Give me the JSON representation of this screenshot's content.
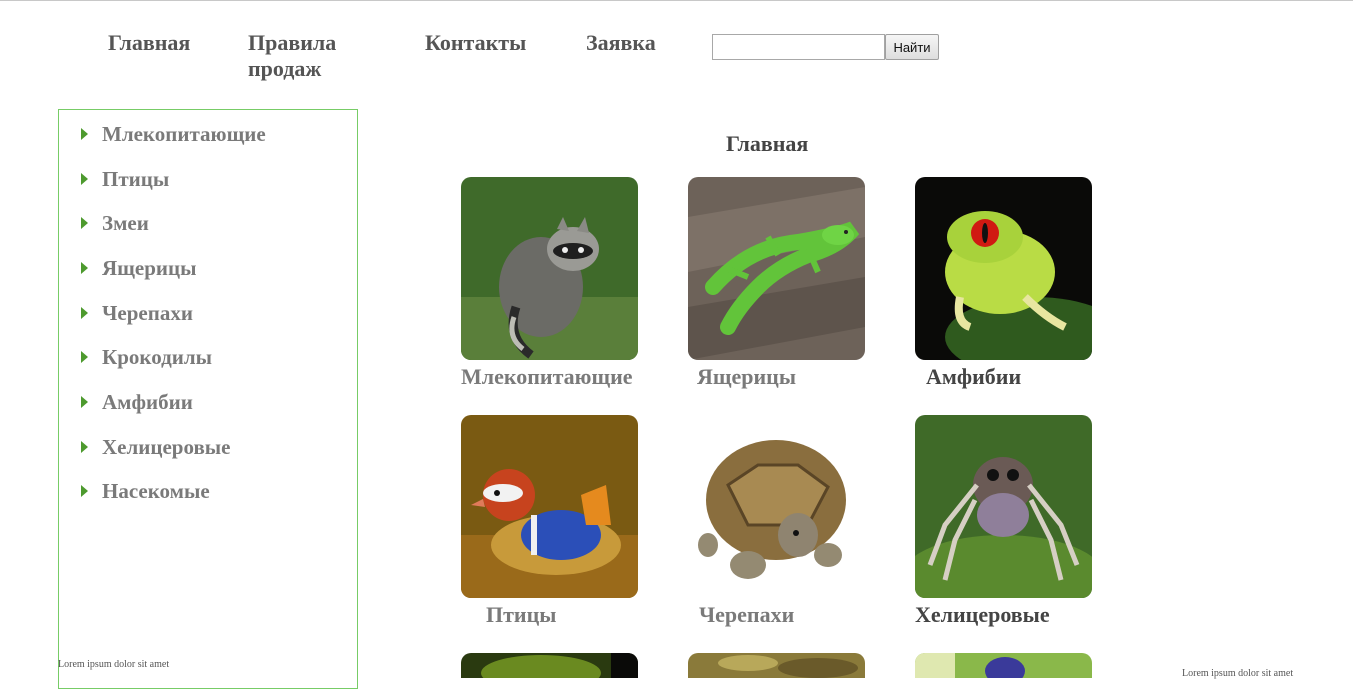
{
  "nav": {
    "home": "Главная",
    "rules": "Правила продаж",
    "contacts": "Контакты",
    "apply": "Заявка"
  },
  "search": {
    "value": "",
    "button": "Найти"
  },
  "sidebar": {
    "items": [
      {
        "label": "Млекопитающие"
      },
      {
        "label": "Птицы"
      },
      {
        "label": "Змеи"
      },
      {
        "label": "Ящерицы"
      },
      {
        "label": "Черепахи"
      },
      {
        "label": "Крокодилы"
      },
      {
        "label": "Амфибии"
      },
      {
        "label": "Хелицеровые"
      },
      {
        "label": "Насекомые"
      }
    ]
  },
  "main": {
    "title": "Главная",
    "cards": [
      {
        "label": "Млекопитающие"
      },
      {
        "label": "Ящерицы"
      },
      {
        "label": "Амфибии"
      },
      {
        "label": "Птицы"
      },
      {
        "label": "Черепахи"
      },
      {
        "label": "Хелицеровые"
      }
    ]
  },
  "footer": {
    "left_text": "Lorem ipsum dolor sit amet",
    "right_text": "Lorem ipsum dolor sit amet"
  },
  "colors": {
    "sidebar_border": "#77cc66",
    "bullet": "#4d9a2e",
    "link_grey": "#7a7a7a",
    "heading_dark": "#444444"
  }
}
